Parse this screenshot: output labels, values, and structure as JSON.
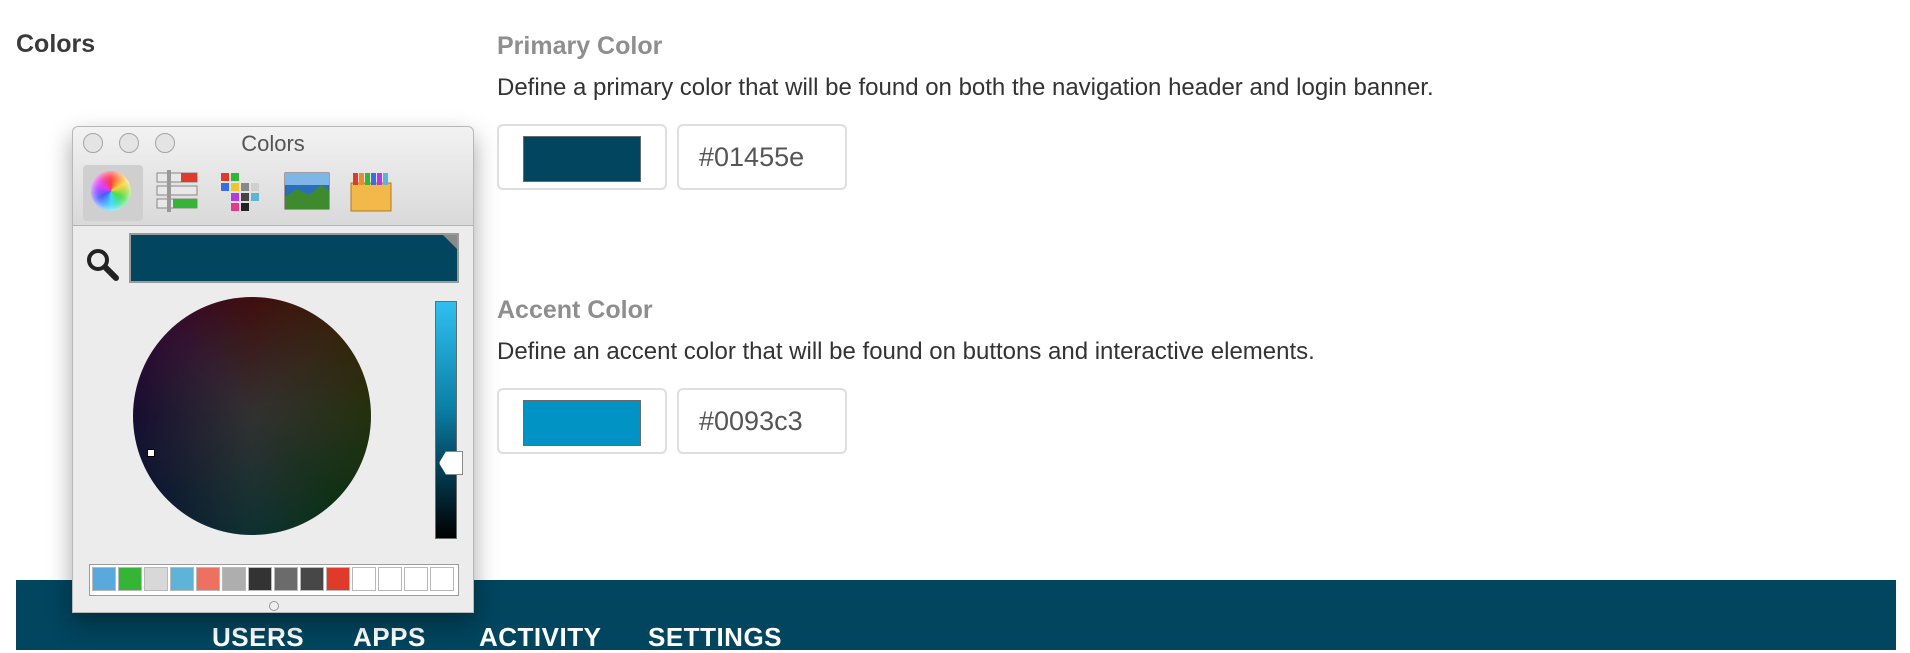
{
  "section": {
    "label": "Colors"
  },
  "primary": {
    "title": "Primary Color",
    "description": "Define a primary color that will be found on both the navigation header and login banner.",
    "value": "#01455e",
    "swatch_color": "#01455e"
  },
  "accent": {
    "title": "Accent Color",
    "description": "Define an accent color that will be found on buttons and interactive elements.",
    "value": "#0093c3",
    "swatch_color": "#0093c3"
  },
  "nav": {
    "background": "#01455e",
    "items": [
      "USERS",
      "APPS",
      "ACTIVITY",
      "SETTINGS"
    ]
  },
  "picker": {
    "title": "Colors",
    "current_color": "#01455e",
    "modes": [
      "color-wheel-icon",
      "sliders-icon",
      "palettes-icon",
      "image-palettes-icon",
      "crayons-icon"
    ],
    "swatches": [
      "#5aa9dc",
      "#34b535",
      "#d8d8d8",
      "#5db3d8",
      "#ee7060",
      "#aeaeae",
      "#333333",
      "#6b6b6b",
      "#474747",
      "#e03a2a",
      "#ffffff",
      "#ffffff",
      "#ffffff",
      "#ffffff"
    ]
  }
}
